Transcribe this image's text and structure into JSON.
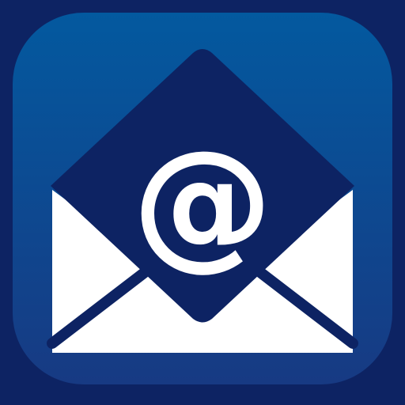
{
  "icon": {
    "name": "email-app-icon",
    "glyph": "@",
    "colors": {
      "frame": "#0d2363",
      "tile_top": "#03599f",
      "tile_bottom": "#173a83",
      "envelope": "#ffffff",
      "envelope_back": "#0d2363",
      "glyph": "#ffffff"
    }
  }
}
